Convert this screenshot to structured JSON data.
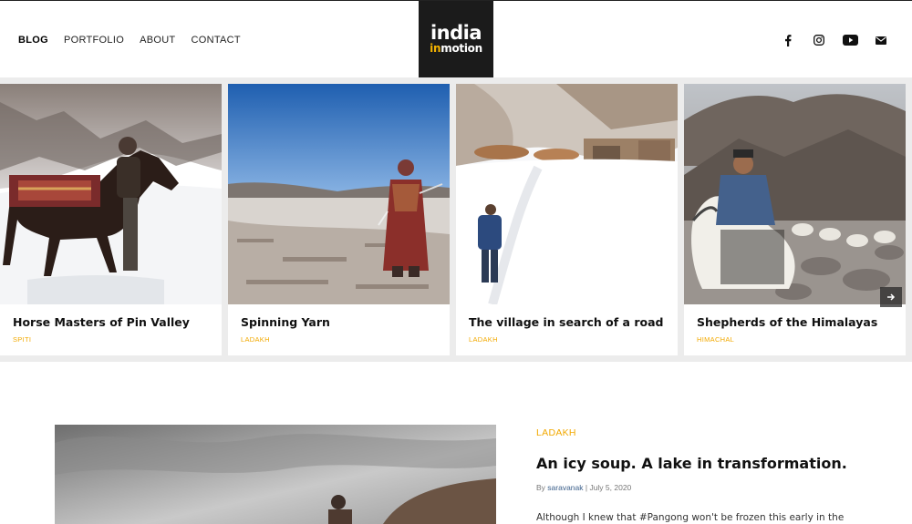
{
  "nav": {
    "items": [
      {
        "label": "BLOG",
        "active": true
      },
      {
        "label": "PORTFOLIO",
        "active": false
      },
      {
        "label": "ABOUT",
        "active": false
      },
      {
        "label": "CONTACT",
        "active": false
      }
    ]
  },
  "logo": {
    "line1": "india",
    "line2_accent": "in",
    "line2_rest": "motion"
  },
  "social": [
    "facebook-icon",
    "instagram-icon",
    "youtube-icon",
    "email-icon"
  ],
  "carousel": {
    "cards": [
      {
        "title": "Horse Masters of Pin Valley",
        "category": "SPITI"
      },
      {
        "title": "Spinning Yarn",
        "category": "LADAKH"
      },
      {
        "title": "The village in search of a road",
        "category": "LADAKH"
      },
      {
        "title": "Shepherds of the Himalayas",
        "category": "HIMACHAL"
      }
    ],
    "next_icon": "arrow-right-icon"
  },
  "post": {
    "category": "LADAKH",
    "title": "An icy soup. A lake in transformation.",
    "meta_by": "By ",
    "author": "saravanak",
    "separator": " | ",
    "date": "July 5, 2020",
    "excerpt": "Although I knew that #Pangong won't be frozen this early in the"
  },
  "colors": {
    "accent": "#f2a900",
    "band": "#ececec",
    "logo_bg": "#1b1b1b"
  }
}
